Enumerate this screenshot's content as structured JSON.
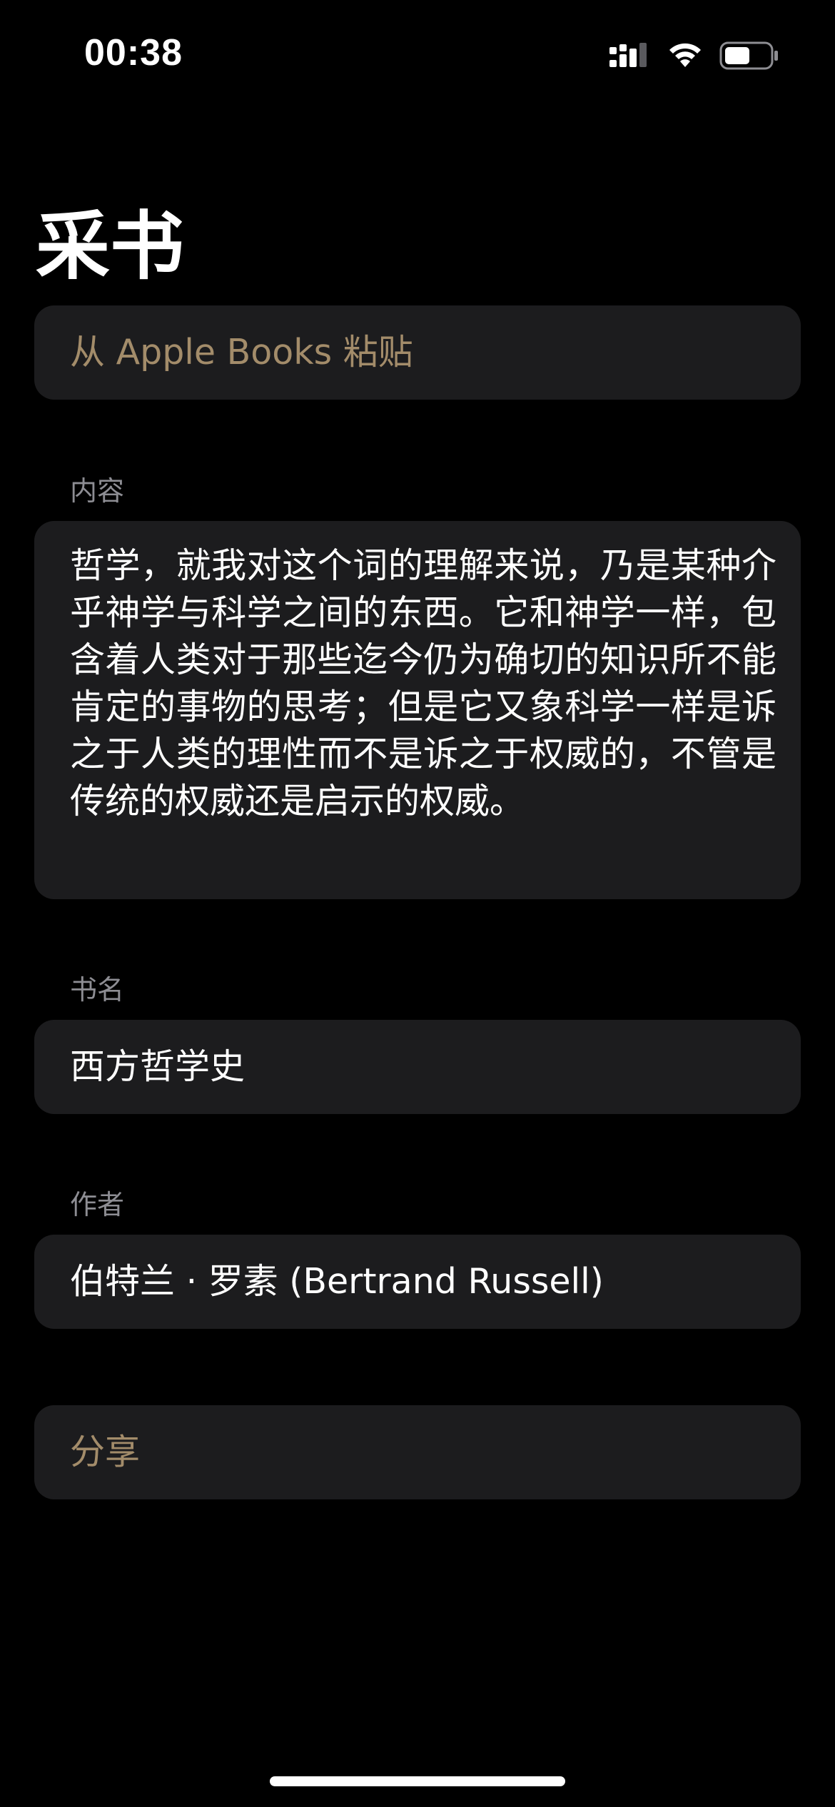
{
  "status_bar": {
    "time": "00:38"
  },
  "page": {
    "title": "采书"
  },
  "actions": {
    "paste_label": "从 Apple Books 粘贴",
    "share_label": "分享"
  },
  "form": {
    "content_label": "内容",
    "content_value": "哲学，就我对这个词的理解来说，乃是某种介乎神学与科学之间的东西。它和神学一样，包含着人类对于那些迄今仍为确切的知识所不能肯定的事物的思考；但是它又象科学一样是诉之于人类的理性而不是诉之于权威的，不管是传统的权威还是启示的权威。",
    "book_label": "书名",
    "book_value": "西方哲学史",
    "author_label": "作者",
    "author_value": "伯特兰 · 罗素 (Bertrand Russell)"
  },
  "colors": {
    "background": "#000000",
    "cell": "#1c1c1e",
    "accent": "#a38c6a",
    "section_label": "#8d8d93"
  },
  "icons": [
    "signal-icon",
    "wifi-icon",
    "battery-icon"
  ]
}
